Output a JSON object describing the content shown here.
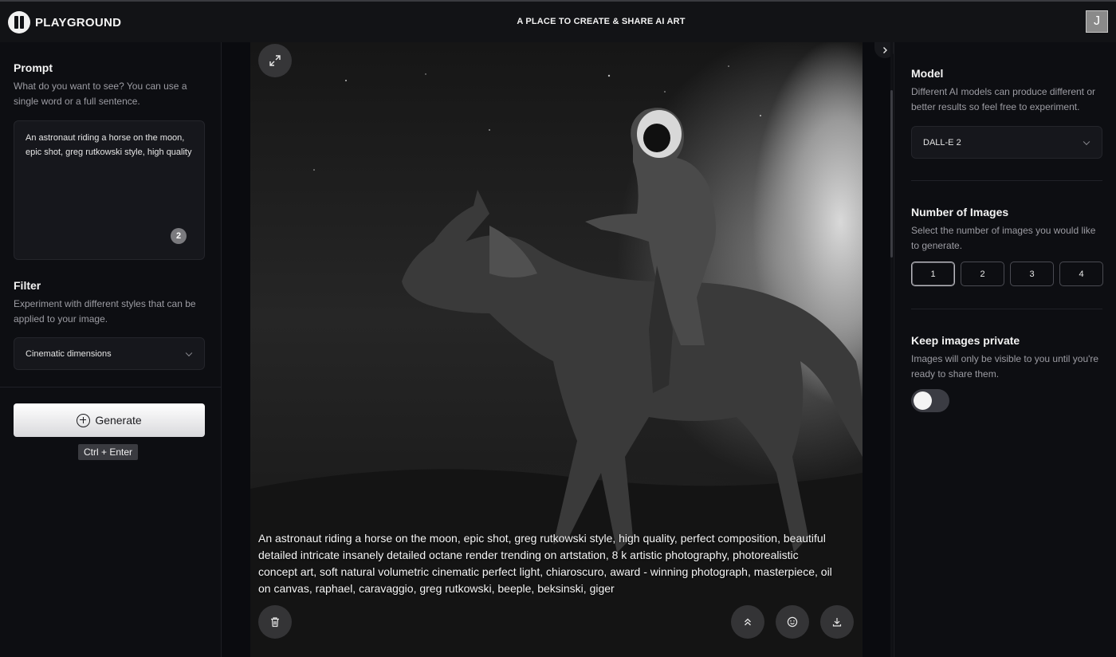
{
  "header": {
    "brand": "PLAYGROUND",
    "tagline": "A PLACE TO CREATE & SHARE AI ART",
    "avatar_initial": "J"
  },
  "prompt": {
    "title": "Prompt",
    "description": "What do you want to see? You can use a single word or a full sentence.",
    "value": "An astronaut riding a horse on the moon, epic shot, greg rutkowski style, high quality",
    "badge_count": "2"
  },
  "filter": {
    "title": "Filter",
    "description": "Experiment with different styles that can be applied to your image.",
    "selected": "Cinematic dimensions"
  },
  "actions": {
    "generate_label": "Generate",
    "shortcut": "Ctrl + Enter"
  },
  "image": {
    "caption": "An astronaut riding a horse on the moon, epic shot, greg rutkowski style, high quality, perfect composition, beautiful detailed intricate insanely detailed octane render trending on artstation, 8 k artistic photography, photorealistic concept art, soft natural volumetric cinematic perfect light, chiaroscuro, award - winning photograph, masterpiece, oil on canvas, raphael, caravaggio, greg rutkowski, beeple, beksinski, giger"
  },
  "model": {
    "title": "Model",
    "description": "Different AI models can produce different or better results so feel free to experiment.",
    "selected": "DALL-E 2"
  },
  "number_of_images": {
    "title": "Number of Images",
    "description": "Select the number of images you would like to generate.",
    "options": [
      "1",
      "2",
      "3",
      "4"
    ],
    "selected": "1"
  },
  "privacy": {
    "title": "Keep images private",
    "description": "Images will only be visible to you until you're ready to share them.",
    "enabled": false
  },
  "icons": {
    "expand": "expand-icon",
    "delete": "trash-icon",
    "upscale": "chevrons-up-icon",
    "react": "smiley-icon",
    "download": "download-icon",
    "collapse": "chevron-right-icon"
  }
}
